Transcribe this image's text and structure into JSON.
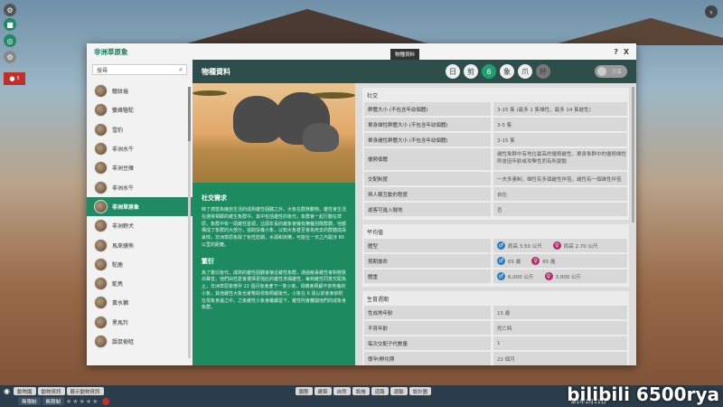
{
  "window": {
    "title": "非洲草原象",
    "help_label": "?",
    "close_label": "X"
  },
  "search": {
    "value": "搜尋"
  },
  "animal_list": [
    {
      "name": "鱷紋龜"
    },
    {
      "name": "雙峰駱駝"
    },
    {
      "name": "雪豹"
    },
    {
      "name": "非洲水牛"
    },
    {
      "name": "非洲豆雁"
    },
    {
      "name": "非洲水牛"
    },
    {
      "name": "非洲草原象",
      "active": true
    },
    {
      "name": "非洲野犬"
    },
    {
      "name": "馬來貘熊"
    },
    {
      "name": "駝鹿"
    },
    {
      "name": "鴕鳥"
    },
    {
      "name": "黃水獺"
    },
    {
      "name": "黑馬羚"
    },
    {
      "name": "鼯鼠樹蛙"
    }
  ],
  "panel": {
    "title": "物種資料",
    "tooltip": "物種資料",
    "share_label": "分享",
    "tabs": [
      "日",
      "剪",
      "6",
      "象",
      "爪",
      "杯"
    ]
  },
  "description": {
    "social_title": "社交需求",
    "social_text": "時了適當為擁自生活的成熟雄性個體之外，大象在群族動物，雄性會生活在通常相鄰的雌生象群中。其中包括雄性的後代，象群會一起行動在草原。象群中有一頭雌性首領，這頭年長的雌象會擁有撫養別隊群體，他都構成了象群的大部分，協助扶養小象，以知大象甚至會為死去的群體成員哀悼，非洲草原象除了有性慾期，水源和快樂，可能在一天之內跋涉 80 公里的距離。",
    "breed_title": "繁衍",
    "breed_text": "為了繁衍後代，成熟的雄性個體會接近雌性象群，通過競爭雌性會對物質出聲音，他們由性愛會選擇更強壯的雄性求偶雄性，每到雌性同意交配為止。非洲草原象懷孕 22 個月後會產下一隻小象，母親會照顧不依地養的小象，其他雌性大象也會幫助母象照顧後代，小象在 6 週以前會會依附在母象身邊之中，之後雌性小象會繼續留下，雄性則會離開他們的成象身象群。"
  },
  "social": {
    "title": "社交",
    "rows": [
      {
        "k": "群體大小 (不包含年幼個體)",
        "v": "3-15 隻 (最多 1 隻雄性，最多 14 隻雌性)"
      },
      {
        "k": "單身雄性群體大小 (不包含年幼個體)",
        "v": "3-5 隻"
      },
      {
        "k": "單身雌性群體大小 (不包含年幼個體)",
        "v": "3-15 隻"
      },
      {
        "k": "優勢個體",
        "v": "雌性象群中有地位最高的優勢雌性，單身象群中的優勢雄性則會因年齡或攻擊性而有所變動",
        "tall": true
      },
      {
        "k": "交配制度",
        "v": "一夫多妻制，雄性有多個雌性伴侶，雌性有一個雄性伴侶"
      },
      {
        "k": "與人類互動的程度",
        "v": "自在"
      },
      {
        "k": "遊客可進入隧地",
        "v": "否"
      }
    ]
  },
  "averages": {
    "title": "平均值",
    "rows": [
      {
        "k": "體型",
        "male": "肩高 3.50 公尺",
        "female": "肩高 2.70 公尺"
      },
      {
        "k": "預期壽命",
        "male": "65 歲",
        "female": "65 歲"
      },
      {
        "k": "體重",
        "male": "6,000 公斤",
        "female": "3,000 公斤"
      }
    ]
  },
  "reproduction": {
    "title": "生育週期",
    "rows": [
      {
        "k": "性成熟年齡",
        "v": "15 歲"
      },
      {
        "k": "不育年齡",
        "v": "死亡時"
      },
      {
        "k": "每次交配子代數量",
        "v": "1"
      },
      {
        "k": "懷孕/孵化期",
        "v": "22 個月"
      }
    ]
  },
  "bottombar": {
    "left_chips": [
      "動物園",
      "動物資訊",
      "展示動物資訊"
    ],
    "tools": [
      "園藝",
      "建築",
      "自然",
      "設施",
      "道路",
      "運輸",
      "設計圖"
    ],
    "status_left": [
      "無限制",
      "無限制"
    ],
    "date": "第1年1月11日",
    "stars": "★★★★★"
  },
  "watermark": "bilibili 6500rya",
  "colors": {
    "accent_green": "#1f8a63",
    "panel_dark": "#2d4e4a",
    "male_blue": "#2a7ac0",
    "female_pink": "#b0306a"
  }
}
